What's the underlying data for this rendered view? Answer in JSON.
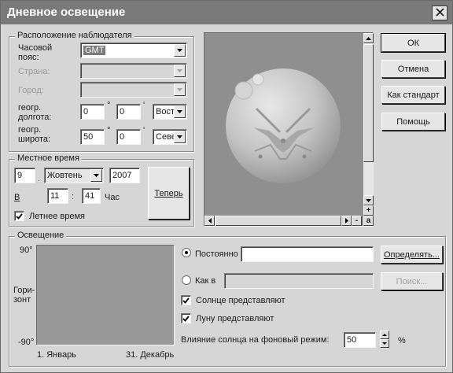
{
  "window": {
    "title": "Дневное освещение"
  },
  "observer": {
    "legend": "Расположение наблюдателя",
    "timezone_label_1": "Часовой",
    "timezone_label_2": "пояс:",
    "timezone_value": "GMT",
    "country_label": "Страна:",
    "city_label": "Город:",
    "longitude_label_1": "геогр.",
    "longitude_label_2": "долгота:",
    "longitude_deg": "0",
    "longitude_min": "0",
    "longitude_dir": "Вост",
    "latitude_label_1": "геогр.",
    "latitude_label_2": "широта:",
    "latitude_deg": "50",
    "latitude_min": "0",
    "latitude_dir": "Севе",
    "deg_sign": "°",
    "min_sign": "'"
  },
  "local_time": {
    "legend": "Местное время",
    "day": "9",
    "dot": ".",
    "month": "Жовтень",
    "year": "2007",
    "at_label": "В",
    "hour": "11",
    "colon": ":",
    "minute": "41",
    "hour_unit": "Час",
    "now_button": "Теперь",
    "dst_label": "Летнее время",
    "dst_checked": true
  },
  "buttons": {
    "ok": "ОК",
    "cancel": "Отмена",
    "default": "Как стандарт",
    "help": "Помощь"
  },
  "preview_controls": {
    "zoom_in": "+",
    "zoom_out": "-",
    "auto": "a"
  },
  "lighting": {
    "legend": "Освещение",
    "y_top": "90°",
    "y_bottom": "-90°",
    "horizon_label_1": "Гори-",
    "horizon_label_2": "зонт",
    "x_start": "1. Январь",
    "x_end": "31. Декабрь",
    "constant_label": "Постоянно",
    "constant_selected": true,
    "constant_value": "",
    "determine_button": "Определять...",
    "as_in_label": "Как в",
    "as_in_value": "",
    "search_button": "Поиск...",
    "sun_label": "Солнце представляют",
    "sun_checked": true,
    "moon_label": "Луну представляют",
    "moon_checked": true,
    "influence_label": "Влияние солнца на фоновый режим:",
    "influence_value": "50",
    "percent": "%"
  }
}
